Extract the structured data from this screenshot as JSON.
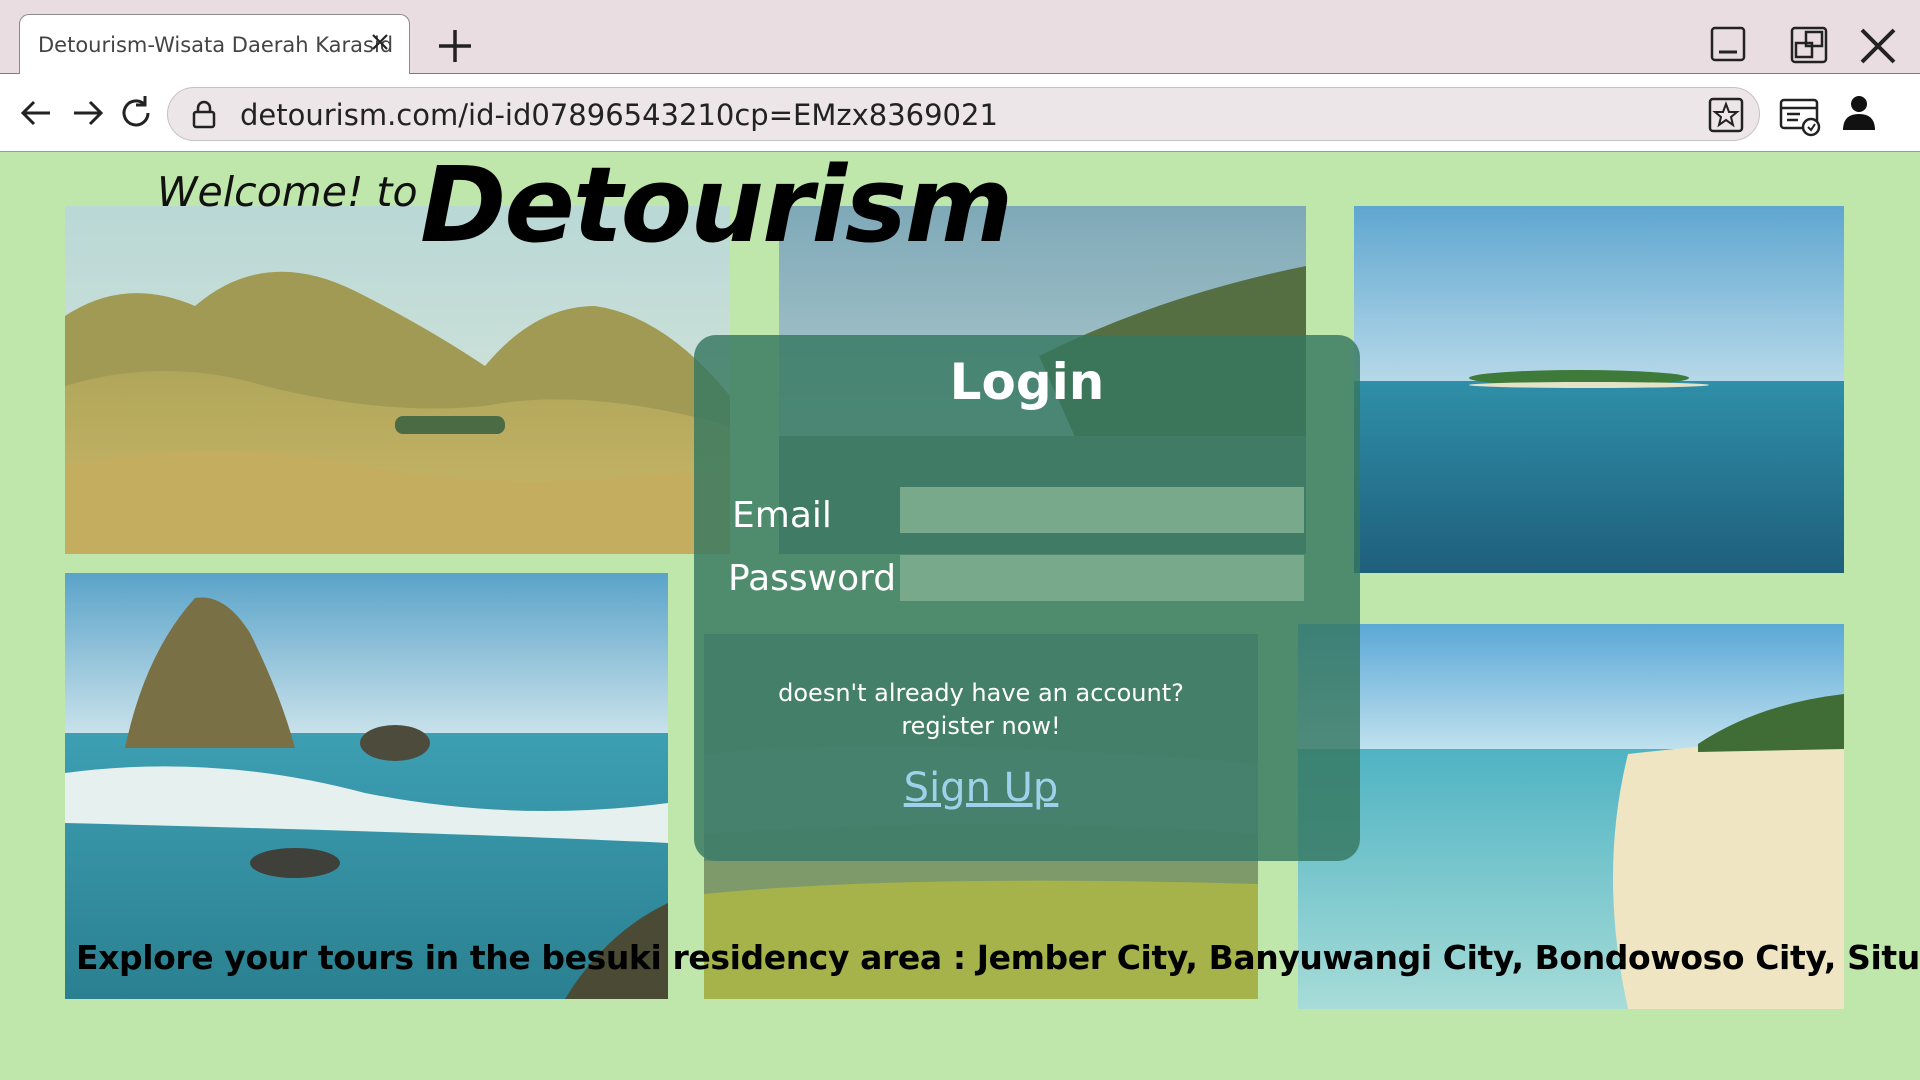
{
  "browser": {
    "tab_title": "Detourism-Wisata Daerah Karasid",
    "url": "detourism.com/id-id07896543210cp=EMzx8369021"
  },
  "hero": {
    "welcome": "Welcome! to",
    "brand": "Detourism"
  },
  "login": {
    "title": "Login",
    "email_label": "Email",
    "password_label": "Password",
    "email_value": "",
    "password_value": "",
    "signup_prompt_line1": "doesn't already have an account?",
    "signup_prompt_line2": "register now!",
    "signup_link": "Sign Up"
  },
  "footer": {
    "tagline": "Explore your tours in the besuki residency area : Jember City, Banyuwangi City, Bondowoso City, Situbondo City"
  },
  "colors": {
    "page_bg": "#bfe6ab",
    "card_bg": "#36785f",
    "link": "#9fd2ea",
    "titlebar": "#e9dde1"
  }
}
